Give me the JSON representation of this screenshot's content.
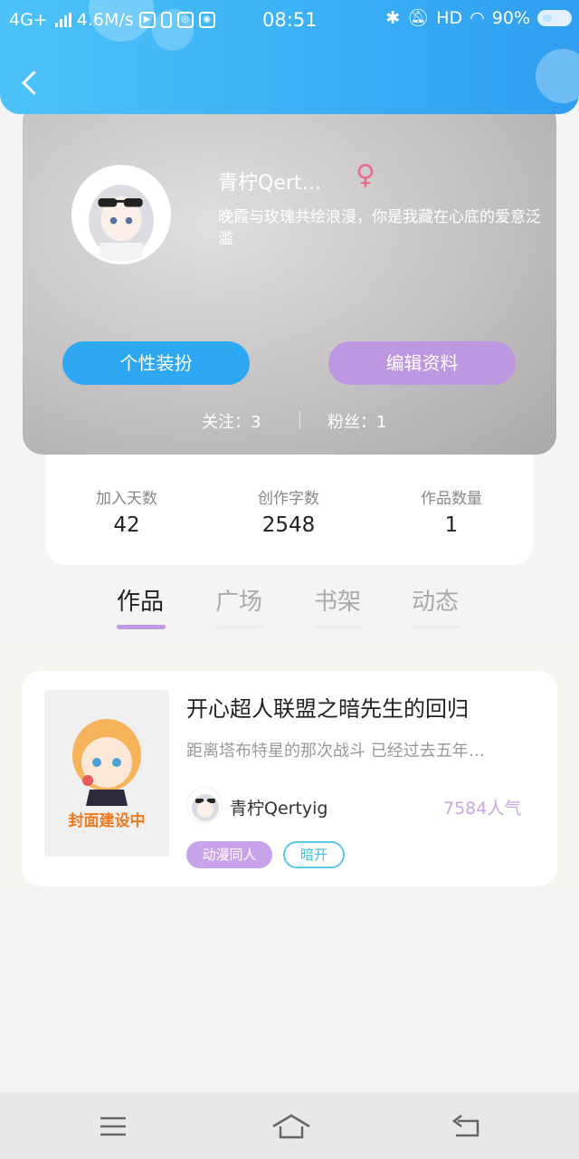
{
  "status_bar": {
    "network": "4G+",
    "speed": "4.6M/s",
    "time": "08:51",
    "hd": "HD",
    "battery": "90%"
  },
  "profile": {
    "name": "青柠Qert…",
    "gender_symbol": "♀",
    "bio": "晚霞与玫瑰共绘浪漫，你是我藏在心底的爱意泛滥",
    "dress_up_label": "个性装扮",
    "edit_label": "编辑资料",
    "following": "关注：3",
    "fans": "粉丝：1"
  },
  "stats": [
    {
      "label": "加入天数",
      "value": "42"
    },
    {
      "label": "创作字数",
      "value": "2548"
    },
    {
      "label": "作品数量",
      "value": "1"
    }
  ],
  "tabs": [
    {
      "label": "作品",
      "active": true
    },
    {
      "label": "广场",
      "active": false
    },
    {
      "label": "书架",
      "active": false
    },
    {
      "label": "动态",
      "active": false
    }
  ],
  "work": {
    "cover_text": "封面建设中",
    "title": "开心超人联盟之暗先生的回归",
    "description": "距离塔布特星的那次战斗 已经过去五年…",
    "author": "青柠Qertyig",
    "popularity": "7584人气",
    "tags": [
      "动漫同人",
      "暗开"
    ]
  },
  "colors": {
    "header_blue": "#3aaef5",
    "dress_button": "#2ea8f2",
    "edit_button": "#bd97e1",
    "tab_active": "#c09be3",
    "popularity": "#c8a6e8"
  }
}
